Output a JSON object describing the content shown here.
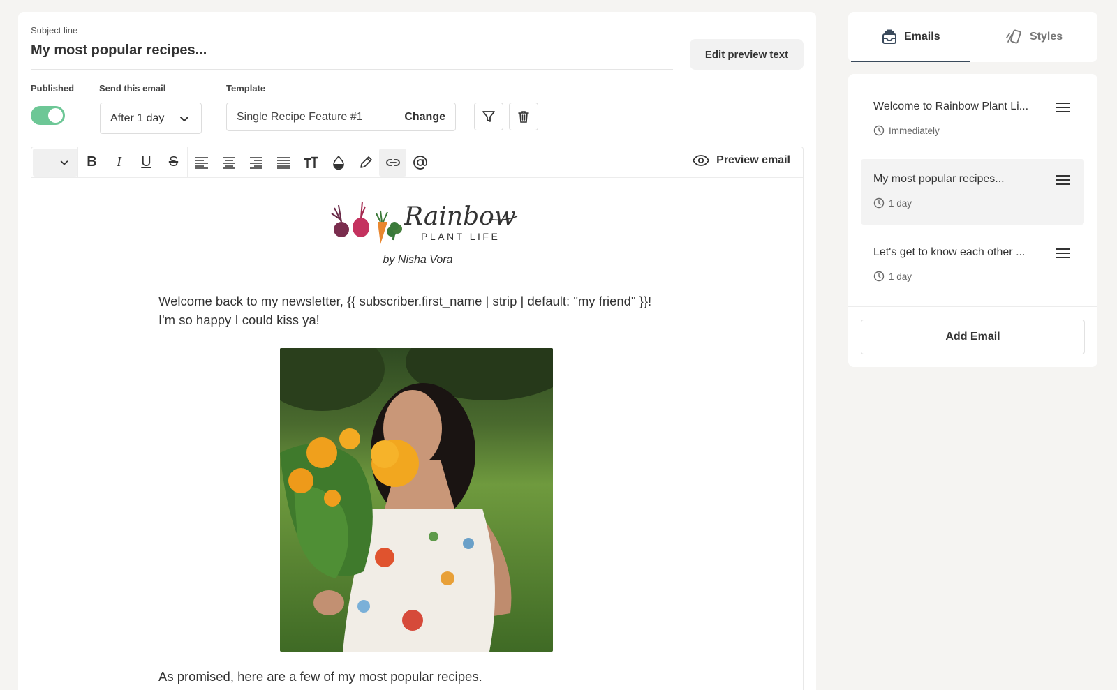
{
  "subject": {
    "label": "Subject line",
    "value": "My most popular recipes..."
  },
  "edit_preview_label": "Edit preview text",
  "published": {
    "label": "Published",
    "on": true
  },
  "send": {
    "label": "Send this email",
    "value": "After 1 day"
  },
  "template": {
    "label": "Template",
    "value": "Single Recipe Feature #1",
    "change_label": "Change"
  },
  "toolbar": {
    "preview_label": "Preview email",
    "buttons": [
      "bold",
      "italic",
      "underline",
      "strikethrough",
      "align-left",
      "align-center",
      "align-right",
      "align-justify",
      "text-size",
      "text-color",
      "highlight",
      "link",
      "mention"
    ]
  },
  "email_body": {
    "logo_text": "Rainbow",
    "logo_subtext": "PLANT LIFE",
    "byline": "by Nisha Vora",
    "para1_line1": "Welcome back to my newsletter, {{ subscriber.first_name | strip | default: \"my friend\" }}!",
    "para1_line2": "I'm so happy I could kiss ya!",
    "para2": "As promised, here are a few of my most popular recipes."
  },
  "tabs": [
    {
      "label": "Emails",
      "icon": "inbox-icon",
      "active": true
    },
    {
      "label": "Styles",
      "icon": "palette-icon",
      "active": false
    }
  ],
  "emails": [
    {
      "title": "Welcome to Rainbow Plant Li...",
      "delay": "Immediately",
      "selected": false
    },
    {
      "title": "My most popular recipes...",
      "delay": "1 day",
      "selected": true
    },
    {
      "title": "Let's get to know each other ...",
      "delay": "1 day",
      "selected": false
    }
  ],
  "add_email_label": "Add Email",
  "colors": {
    "toggle_on": "#6dc796",
    "tab_underline": "#3a4a5c"
  }
}
